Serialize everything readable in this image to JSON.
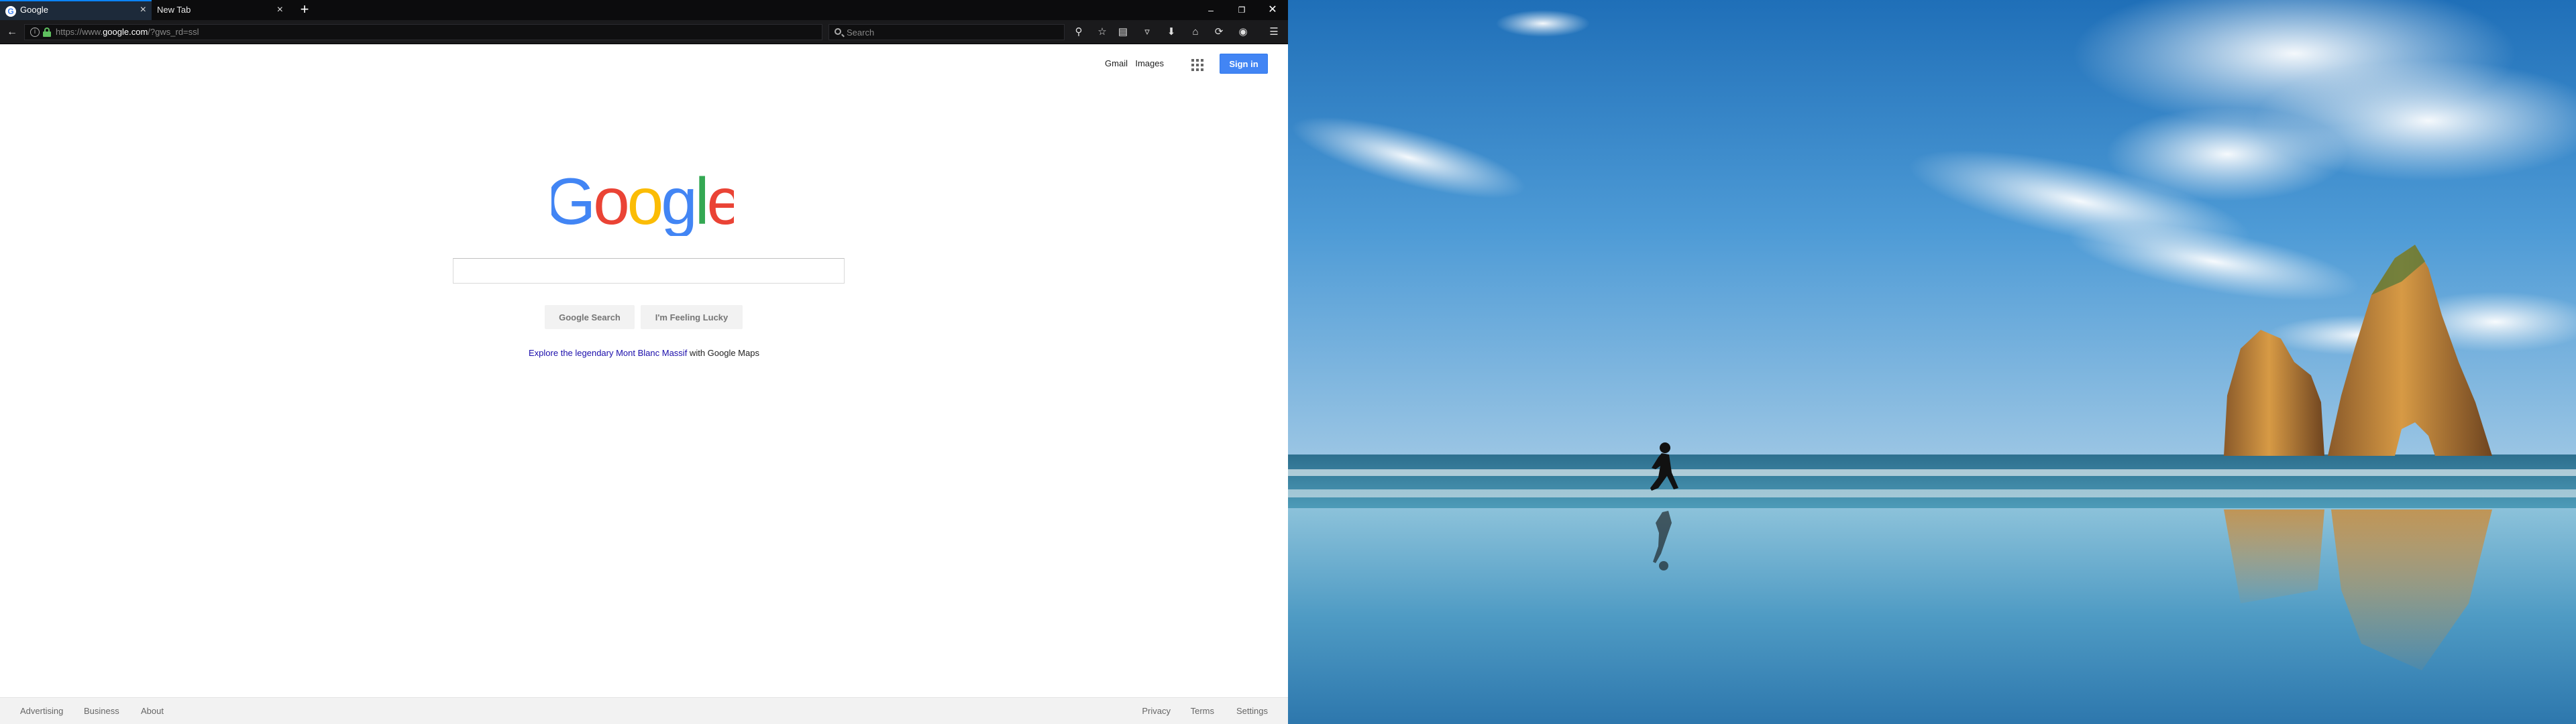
{
  "browser": {
    "tabs": [
      {
        "title": "Google",
        "favicon": "G",
        "active": true
      },
      {
        "title": "New Tab",
        "active": false
      }
    ],
    "new_tab_icon": "+",
    "close_icon": "×",
    "window_controls": {
      "minimize": "–",
      "maximize": "❐",
      "close": "✕"
    },
    "url": {
      "scheme": "https://www.",
      "domain": "google.com",
      "path": "/?gws_rd=ssl"
    },
    "search_placeholder": "Search",
    "toolbar_icons": [
      "wrench-icon",
      "bookmark-star-icon",
      "reading-list-icon",
      "pocket-icon",
      "download-icon",
      "home-icon",
      "sync-icon",
      "account-icon",
      "menu-icon"
    ]
  },
  "google": {
    "top_links": {
      "gmail": "Gmail",
      "images": "Images"
    },
    "signin": "Sign in",
    "logo_text": "Google",
    "logo_colors": [
      "#4285F4",
      "#EA4335",
      "#FBBC05",
      "#4285F4",
      "#34A853",
      "#EA4335"
    ],
    "buttons": {
      "search": "Google Search",
      "lucky": "I'm Feeling Lucky"
    },
    "promo": {
      "link": "Explore the legendary Mont Blanc Massif",
      "suffix": " with Google Maps"
    },
    "footer": {
      "left": [
        "Advertising",
        "Business",
        "About"
      ],
      "right": [
        "Privacy",
        "Terms",
        "Settings"
      ]
    }
  },
  "desktop": {
    "wallpaper": "beach-with-runner-and-rock-arches"
  }
}
